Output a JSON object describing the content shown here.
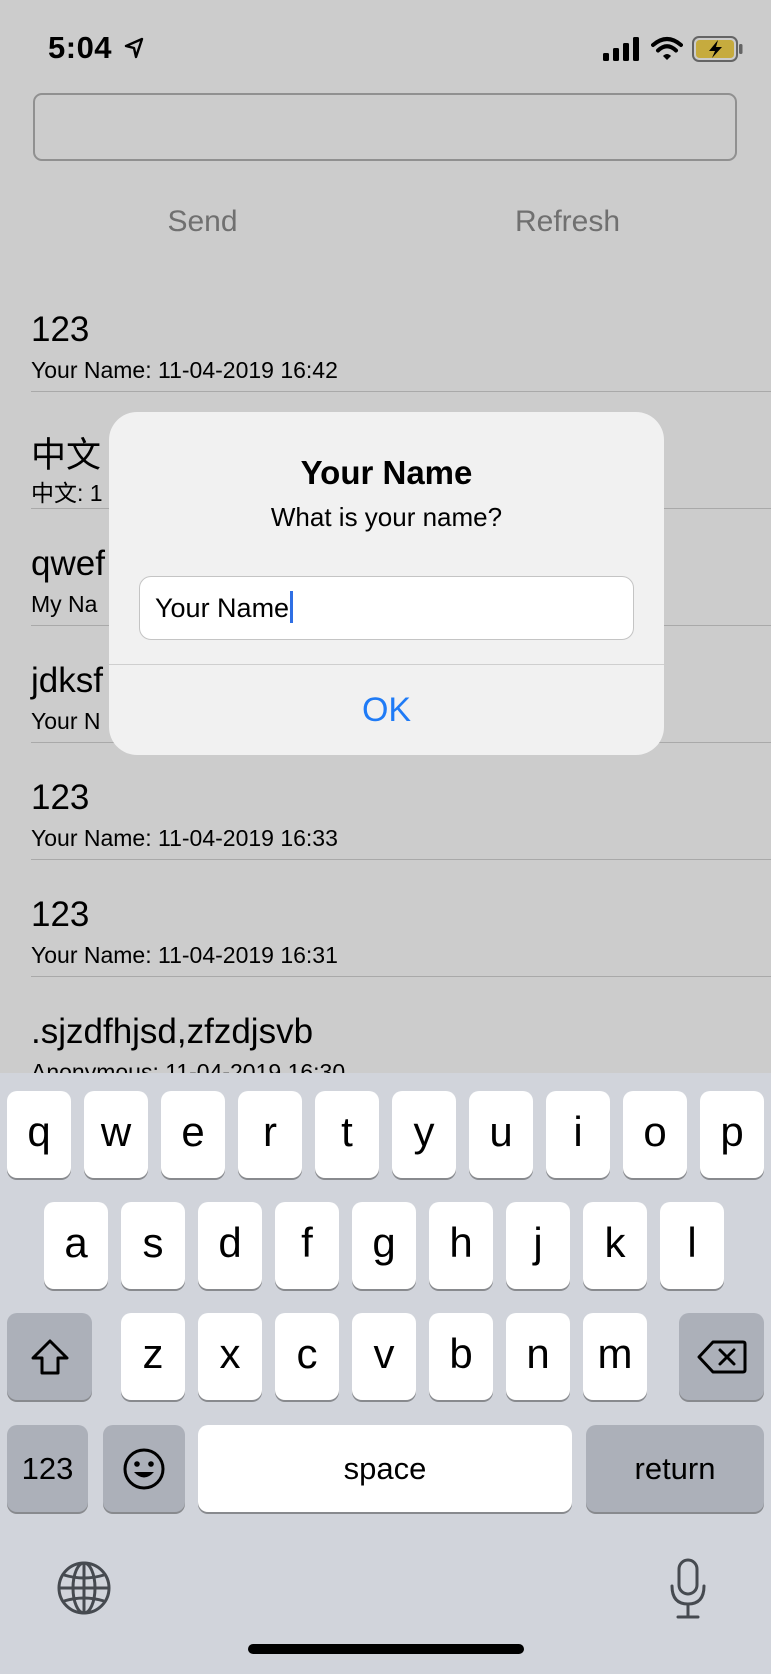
{
  "status_bar": {
    "time": "5:04",
    "icons": [
      "location-arrow-icon",
      "cellular-signal-icon",
      "wifi-icon",
      "battery-charging-icon"
    ],
    "battery_color": "#f8d64e"
  },
  "compose": {
    "input_value": "",
    "send_label": "Send",
    "refresh_label": "Refresh"
  },
  "messages": [
    {
      "title": "123",
      "subtitle": "Your Name: 11-04-2019 16:42"
    },
    {
      "title": "中文",
      "subtitle": "中文: 1"
    },
    {
      "title": "qwef",
      "subtitle": "My Na"
    },
    {
      "title": "jdksf",
      "subtitle": "Your N"
    },
    {
      "title": "123",
      "subtitle": "Your Name: 11-04-2019 16:33"
    },
    {
      "title": "123",
      "subtitle": "Your Name: 11-04-2019 16:31"
    },
    {
      "title": ".sjzdfhjsd,zfzdjsvb",
      "subtitle": "Anonymous: 11-04-2019 16:30"
    }
  ],
  "dialog": {
    "title": "Your Name",
    "message": "What is your name?",
    "field_value": "Your Name",
    "ok_label": "OK",
    "accent_color": "#1f7bf6"
  },
  "keyboard": {
    "row1": [
      "q",
      "w",
      "e",
      "r",
      "t",
      "y",
      "u",
      "i",
      "o",
      "p"
    ],
    "row2": [
      "a",
      "s",
      "d",
      "f",
      "g",
      "h",
      "j",
      "k",
      "l"
    ],
    "row3": [
      "z",
      "x",
      "c",
      "v",
      "b",
      "n",
      "m"
    ],
    "numbers_label": "123",
    "space_label": "space",
    "return_label": "return",
    "icons": [
      "shift-icon",
      "backspace-icon",
      "emoji-icon",
      "globe-icon",
      "microphone-icon"
    ]
  }
}
